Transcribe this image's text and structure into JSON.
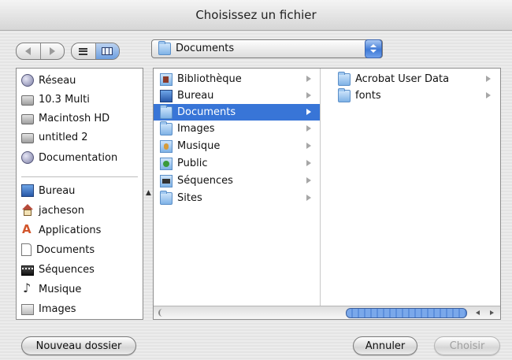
{
  "window": {
    "title": "Choisissez un fichier"
  },
  "toolbar": {
    "location_popup": {
      "label": "Documents",
      "icon": "documents-folder-icon"
    }
  },
  "sidebar": {
    "devices": [
      {
        "label": "Réseau",
        "icon": "network-globe-icon"
      },
      {
        "label": "10.3 Multi",
        "icon": "hard-disk-icon"
      },
      {
        "label": "Macintosh HD",
        "icon": "hard-disk-icon"
      },
      {
        "label": "untitled 2",
        "icon": "hard-disk-icon"
      },
      {
        "label": "Documentation",
        "icon": "network-globe-icon"
      }
    ],
    "places": [
      {
        "label": "Bureau",
        "icon": "desktop-icon"
      },
      {
        "label": "jacheson",
        "icon": "home-icon"
      },
      {
        "label": "Applications",
        "icon": "applications-icon"
      },
      {
        "label": "Documents",
        "icon": "document-icon"
      },
      {
        "label": "Séquences",
        "icon": "movies-icon"
      },
      {
        "label": "Musique",
        "icon": "music-icon"
      },
      {
        "label": "Images",
        "icon": "pictures-icon"
      }
    ]
  },
  "browser": {
    "column1": [
      {
        "label": "Bibliothèque",
        "icon": "library-folder-icon",
        "selected": false
      },
      {
        "label": "Bureau",
        "icon": "desktop-icon",
        "selected": false
      },
      {
        "label": "Documents",
        "icon": "documents-folder-icon",
        "selected": true
      },
      {
        "label": "Images",
        "icon": "pictures-folder-icon",
        "selected": false
      },
      {
        "label": "Musique",
        "icon": "music-folder-icon",
        "selected": false
      },
      {
        "label": "Public",
        "icon": "public-folder-icon",
        "selected": false
      },
      {
        "label": "Séquences",
        "icon": "movies-folder-icon",
        "selected": false
      },
      {
        "label": "Sites",
        "icon": "folder-icon",
        "selected": false
      }
    ],
    "column2": [
      {
        "label": "Acrobat User Data",
        "icon": "folder-icon"
      },
      {
        "label": "fonts",
        "icon": "folder-icon"
      }
    ]
  },
  "buttons": {
    "new_folder": "Nouveau dossier",
    "cancel": "Annuler",
    "choose": "Choisir"
  },
  "colors": {
    "selection": "#3875d7",
    "accent_blue": "#4a84de"
  }
}
